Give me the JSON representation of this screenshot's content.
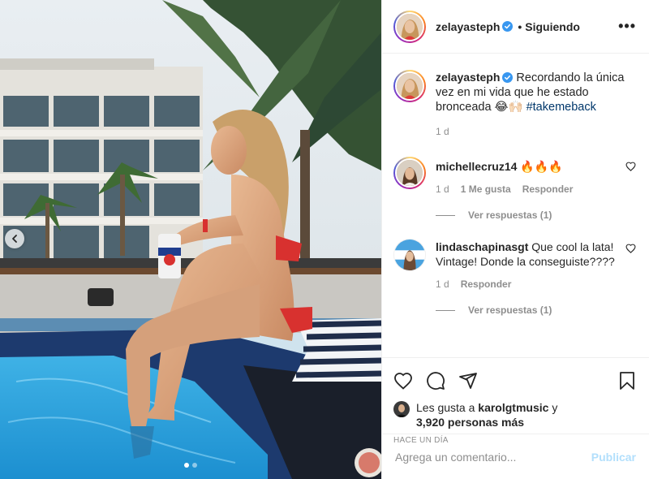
{
  "post": {
    "photo": {
      "prev_icon": "chevron-left-icon",
      "carousel": {
        "total": 2,
        "active": 1
      }
    },
    "header": {
      "username": "zelayasteph",
      "verified_icon": "verified-badge-icon",
      "separator": "•",
      "follow_status": "Siguiendo",
      "more_icon": "more-options-icon",
      "more_label": "•••"
    },
    "caption": {
      "username": "zelayasteph",
      "text": "Recordando la única vez en mi vida que he estado bronceada 😂🙌🏻",
      "hashtag": "#takemeback",
      "time": "1 d"
    },
    "comments": [
      {
        "username": "michellecruz14",
        "text": "🔥🔥🔥",
        "time": "1 d",
        "likes": "1 Me gusta",
        "reply_label": "Responder",
        "view_replies": "Ver respuestas (1)"
      },
      {
        "username": "lindaschapinasgt",
        "text": "Que cool la lata! Vintage! Donde la conseguiste????",
        "time": "1 d",
        "reply_label": "Responder",
        "view_replies": "Ver respuestas (1)"
      }
    ],
    "actions": {
      "like_icon": "heart-icon",
      "comment_icon": "comment-icon",
      "share_icon": "paper-plane-icon",
      "save_icon": "bookmark-icon"
    },
    "likes": {
      "prefix": "Les gusta a",
      "user": "karolgtmusic",
      "and": "y",
      "others": "3,920 personas más"
    },
    "timestamp": "HACE UN DÍA",
    "add_comment": {
      "placeholder": "Agrega un comentario...",
      "publish_label": "Publicar"
    },
    "colors": {
      "hashtag": "#00376b",
      "publish_disabled": "#b2dffc",
      "verified": "#3897f0",
      "secondary_text": "#8e8e8e"
    }
  }
}
